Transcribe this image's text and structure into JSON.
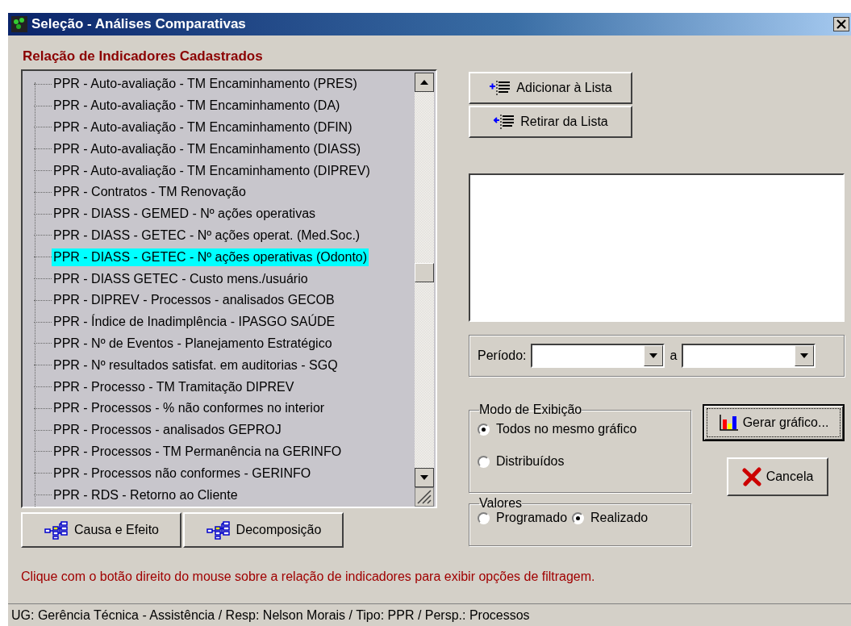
{
  "window": {
    "title": "Seleção - Análises Comparativas"
  },
  "list_heading": "Relação de Indicadores Cadastrados",
  "indicators": [
    {
      "label": "PPR - Auto-avaliação -  TM Encaminhamento (PRES)",
      "selected": false
    },
    {
      "label": "PPR - Auto-avaliação - TM Encaminhamento (DA)",
      "selected": false
    },
    {
      "label": "PPR - Auto-avaliação - TM Encaminhamento (DFIN)",
      "selected": false
    },
    {
      "label": "PPR - Auto-avaliação - TM Encaminhamento (DIASS)",
      "selected": false
    },
    {
      "label": "PPR - Auto-avaliação - TM Encaminhamento (DIPREV)",
      "selected": false
    },
    {
      "label": "PPR - Contratos - TM Renovação",
      "selected": false
    },
    {
      "label": "PPR - DIASS - GEMED - Nº ações operativas",
      "selected": false
    },
    {
      "label": "PPR - DIASS - GETEC - Nº ações operat. (Med.Soc.)",
      "selected": false
    },
    {
      "label": "PPR - DIASS - GETEC - Nº ações operativas (Odonto)",
      "selected": true
    },
    {
      "label": "PPR - DIASS GETEC -  Custo mens./usuário",
      "selected": false
    },
    {
      "label": "PPR - DIPREV - Processos - analisados GECOB",
      "selected": false
    },
    {
      "label": "PPR - Índice de Inadimplência - IPASGO SAÚDE",
      "selected": false
    },
    {
      "label": "PPR - Nº de Eventos - Planejamento Estratégico",
      "selected": false
    },
    {
      "label": "PPR - Nº resultados satisfat. em auditorias - SGQ",
      "selected": false
    },
    {
      "label": "PPR - Processo - TM Tramitação DIPREV",
      "selected": false
    },
    {
      "label": "PPR - Processos - % não conformes no interior",
      "selected": false
    },
    {
      "label": "PPR - Processos - analisados GEPROJ",
      "selected": false
    },
    {
      "label": "PPR - Processos - TM Permanência na GERINFO",
      "selected": false
    },
    {
      "label": "PPR - Processos não conformes - GERINFO",
      "selected": false
    },
    {
      "label": "PPR - RDS - Retorno ao Cliente",
      "selected": false
    }
  ],
  "list_buttons": [
    {
      "label": "Causa e Efeito"
    },
    {
      "label": "Decomposição"
    }
  ],
  "move_buttons": [
    {
      "label": "Adicionar à Lista",
      "kind": "add"
    },
    {
      "label": "Retirar da Lista",
      "kind": "remove"
    }
  ],
  "period": {
    "label": "Período:",
    "separator": "a"
  },
  "display_mode": {
    "title": "Modo de Exibição",
    "options": [
      {
        "label": "Todos no mesmo gráfico",
        "selected": true
      },
      {
        "label": "Distribuídos",
        "selected": false
      }
    ]
  },
  "values": {
    "title": "Valores",
    "options": [
      {
        "label": "Programado",
        "selected": false
      },
      {
        "label": "Realizado",
        "selected": true
      }
    ]
  },
  "generate_button": "Gerar gráfico...",
  "cancel_button": "Cancela",
  "hint": "Clique com o botão direito do mouse sobre a relação de indicadores para exibir opções de filtragem.",
  "status_bar": "UG: Gerência Técnica - Assistência / Resp: Nelson Morais / Tipo: PPR / Persp.: Processos"
}
